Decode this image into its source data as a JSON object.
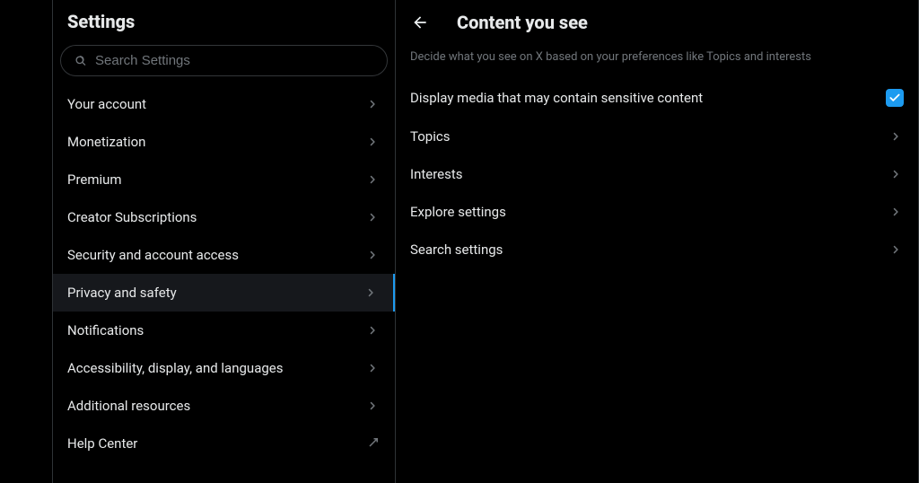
{
  "sidebar": {
    "title": "Settings",
    "search_placeholder": "Search Settings",
    "items": [
      {
        "label": "Your account"
      },
      {
        "label": "Monetization"
      },
      {
        "label": "Premium"
      },
      {
        "label": "Creator Subscriptions"
      },
      {
        "label": "Security and account access"
      },
      {
        "label": "Privacy and safety"
      },
      {
        "label": "Notifications"
      },
      {
        "label": "Accessibility, display, and languages"
      },
      {
        "label": "Additional resources"
      },
      {
        "label": "Help Center"
      }
    ]
  },
  "main": {
    "title": "Content you see",
    "description": "Decide what you see on X based on your preferences like Topics and interests",
    "items": [
      {
        "label": "Display media that may contain sensitive content"
      },
      {
        "label": "Topics"
      },
      {
        "label": "Interests"
      },
      {
        "label": "Explore settings"
      },
      {
        "label": "Search settings"
      }
    ]
  }
}
